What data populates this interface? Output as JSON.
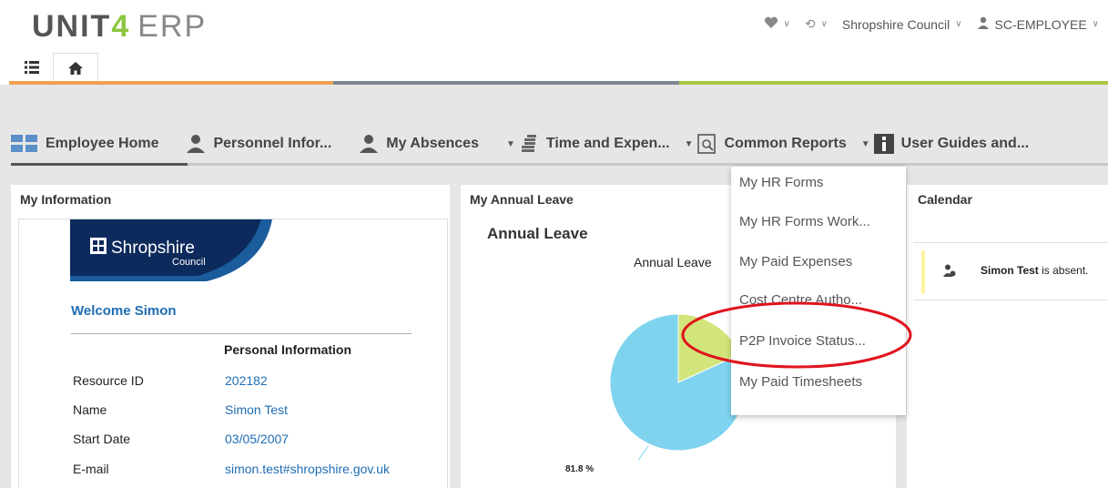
{
  "header": {
    "logo_unit": "UNIT",
    "logo_four": "4",
    "logo_erp": "ERP",
    "organisation": "Shropshire Council",
    "user": "SC-EMPLOYEE"
  },
  "nav": {
    "items": [
      {
        "label": "Employee Home"
      },
      {
        "label": "Personnel Infor..."
      },
      {
        "label": "My Absences"
      },
      {
        "label": "Time and Expen..."
      },
      {
        "label": "Common Reports"
      },
      {
        "label": "User Guides and..."
      }
    ]
  },
  "my_information": {
    "title": "My Information",
    "logo_text": "Shropshire",
    "logo_sub": "Council",
    "welcome": "Welcome Simon",
    "section_heading": "Personal Information",
    "fields": [
      {
        "label": "Resource ID",
        "value": "202182"
      },
      {
        "label": "Name",
        "value": "Simon Test"
      },
      {
        "label": "Start Date",
        "value": "03/05/2007"
      },
      {
        "label": "E-mail",
        "value": "simon.test#shropshire.gov.uk"
      }
    ]
  },
  "annual_leave": {
    "title": "My Annual Leave",
    "heading": "Annual Leave",
    "chart_title": "Annual Leave",
    "pct_label": "81.8 %"
  },
  "chart_data": {
    "type": "pie",
    "title": "Annual Leave",
    "slices": [
      {
        "value": 81.8,
        "label": "81.8 %",
        "color": "#7fd3ee"
      },
      {
        "value": 18.2,
        "label": "",
        "color": "#d2e57a"
      }
    ]
  },
  "dropdown": {
    "items": [
      {
        "label": "My HR Forms"
      },
      {
        "label": "My HR Forms Work..."
      },
      {
        "label": "My Paid Expenses"
      },
      {
        "label": "Cost Centre Autho..."
      },
      {
        "label": "P2P Invoice Status..."
      },
      {
        "label": "My Paid Timesheets"
      }
    ]
  },
  "calendar": {
    "title": "Calendar",
    "entry_name": "Simon Test",
    "entry_text": " is absent."
  },
  "colors": {
    "accent_blue": "#1f6db3",
    "orange": "#f0a050",
    "green": "#a8c83c",
    "gray": "#7d8790",
    "highlight": "#e0141e"
  }
}
